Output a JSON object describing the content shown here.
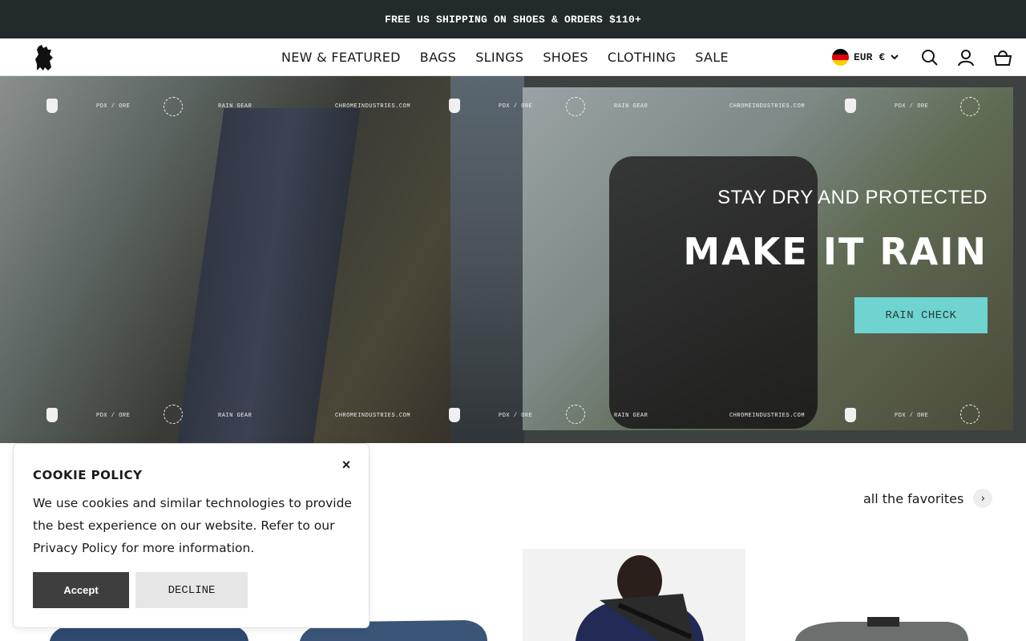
{
  "announcement": {
    "text": "FREE US SHIPPING ON SHOES & ORDERS $110+"
  },
  "header": {
    "logo_icon": "chrome-griffin-logo",
    "nav": [
      "NEW & FEATURED",
      "BAGS",
      "SLINGS",
      "SHOES",
      "CLOTHING",
      "SALE"
    ],
    "locale": {
      "flag": "germany-flag-icon",
      "currency": "EUR €"
    },
    "icons": [
      "search-icon",
      "account-icon",
      "cart-icon"
    ]
  },
  "hero": {
    "subtitle": "STAY DRY AND PROTECTED",
    "title": "MAKE IT RAIN",
    "cta": "RAIN CHECK",
    "cta_color": "#6fd4cf",
    "band_texts": [
      "PDX / ORE",
      "RAIN GEAR",
      "CHROMEINDUSTRIES.COM"
    ]
  },
  "favorites": {
    "link": "all the favorites"
  },
  "cookie": {
    "title": "COOKIE POLICY",
    "body": "We use cookies and similar technologies to provide the best experience on our website. Refer to our Privacy Policy for more information.",
    "accept": "Accept",
    "decline": "DECLINE",
    "close": "×"
  }
}
